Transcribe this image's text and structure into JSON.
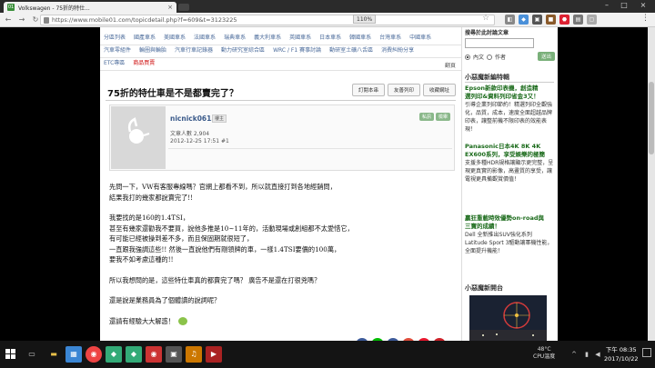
{
  "browser": {
    "tab_title": "Volkswagen - 75折的特仕...",
    "tab_favicon": "01",
    "url": "https://www.mobile01.com/topicdetail.php?f=609&t=3123225",
    "zoom": "110%"
  },
  "nav": {
    "categories": [
      "分區列表",
      "國產車系",
      "美國車系",
      "法國車系",
      "瑞典車系",
      "義大利車系",
      "英國車系",
      "日本車系",
      "韓國車系",
      "台灣車系",
      "中國車系",
      "汽車零組件",
      "輪圈與輪胎",
      "汽車行車記錄器",
      "動力研究室綜合區",
      "WRC / F1 賽事討論",
      "動研室土礦八舌區",
      "消費糾紛分享",
      "ETC專區"
    ],
    "sale": "商品買賣",
    "print": "翻頁"
  },
  "post": {
    "title": "75折的特仕車是不是都賣完了？",
    "btn_subscribe": "訂閱本串",
    "btn_print": "友善列印",
    "btn_bookmark": "收藏網址",
    "author": "nicnick0613",
    "author_level": "樓主",
    "badge_a": "私訊",
    "badge_b": "檢舉",
    "post_count": "文章人數 2,904",
    "datetime": "2012-12-25 17:51   #1",
    "body": [
      "先問一下，VW有客服專線嗎？官網上都看不到，所以就直接打到各地經銷問，",
      "結果我打的幾家都說賣完了!!",
      "我要找的是160的1.4TSI，",
      "甚至有幾家還勸我不要買，說他多推是10~11年的，活動現場或創組都不太愛惜它，",
      "有可能已經被操到差不多，而且保固期就很短了，",
      "一直跟我強調這些!! 然後一直說他們有剛領牌的車，一樣1.4TSI要價的100萬，",
      "要我不如考慮這種的!!",
      "所以我想問的是，這些特仕車真的都賣完了嗎？ 廣告不是還在打很兇嗎？",
      "還是說是業務員為了個體讀的說詞呢？",
      "還請有經驗大大解惑！"
    ]
  },
  "sidebar": {
    "search_label": "搜尋於此討論文章",
    "search_value": "",
    "radio_content": "內文",
    "radio_author": "作者",
    "go": "送出",
    "section1": "小惡魔新編特輯",
    "promo1_title": "Epson新款印表機，創造精",
    "promo1_sub": "選列印&資料列印省金3又！",
    "promo1_text": "引導企業列印節約！精選列印全觀強化，品質，成本，速度全面超越品牌印表，讓整前機不限印表的效能表現！",
    "promo2_title": "Panasonic日本4K 8K 4K",
    "promo2_sub": "EX600系列，享受娛樂的極簡",
    "promo2_text": "支援多種HDR規格讓顯示更完整，呈現更真實的影像，高畫質的享受，讓電視更具備觀賞價值！",
    "promo3_title": "贏狂重載時效優勢on-road與",
    "promo3_sub": "三寶的成績！",
    "promo3_text": "Dell 全新推出SUV強化系列 Latitude Sport 3驅動讓軍機性能，全面提升機能！",
    "section2": "小惡魔新開台"
  },
  "taskbar": {
    "temp": "48°C",
    "cpu": "CPU溫度",
    "time": "下午 08:35",
    "date": "2017/10/22"
  }
}
